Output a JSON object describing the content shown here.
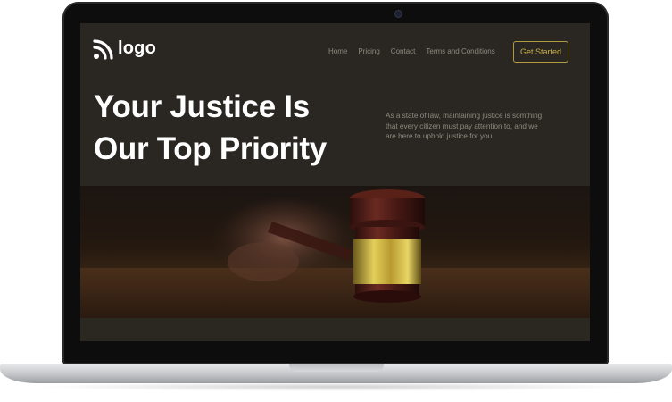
{
  "nav": {
    "logo_text": "logo",
    "links": [
      "Home",
      "Pricing",
      "Contact",
      "Terms and Conditions"
    ],
    "cta_label": "Get Started"
  },
  "hero": {
    "title": "Your Justice Is Our Top Priority",
    "description": "As a state of law, maintaining justice is somthing that every citizen must pay attention to, and we are here to uphold justice for you",
    "image_subject": "gavel"
  },
  "colors": {
    "background": "#2a2722",
    "accent": "#c7b046",
    "text_primary": "#ffffff",
    "text_muted": "#8e8a80"
  }
}
